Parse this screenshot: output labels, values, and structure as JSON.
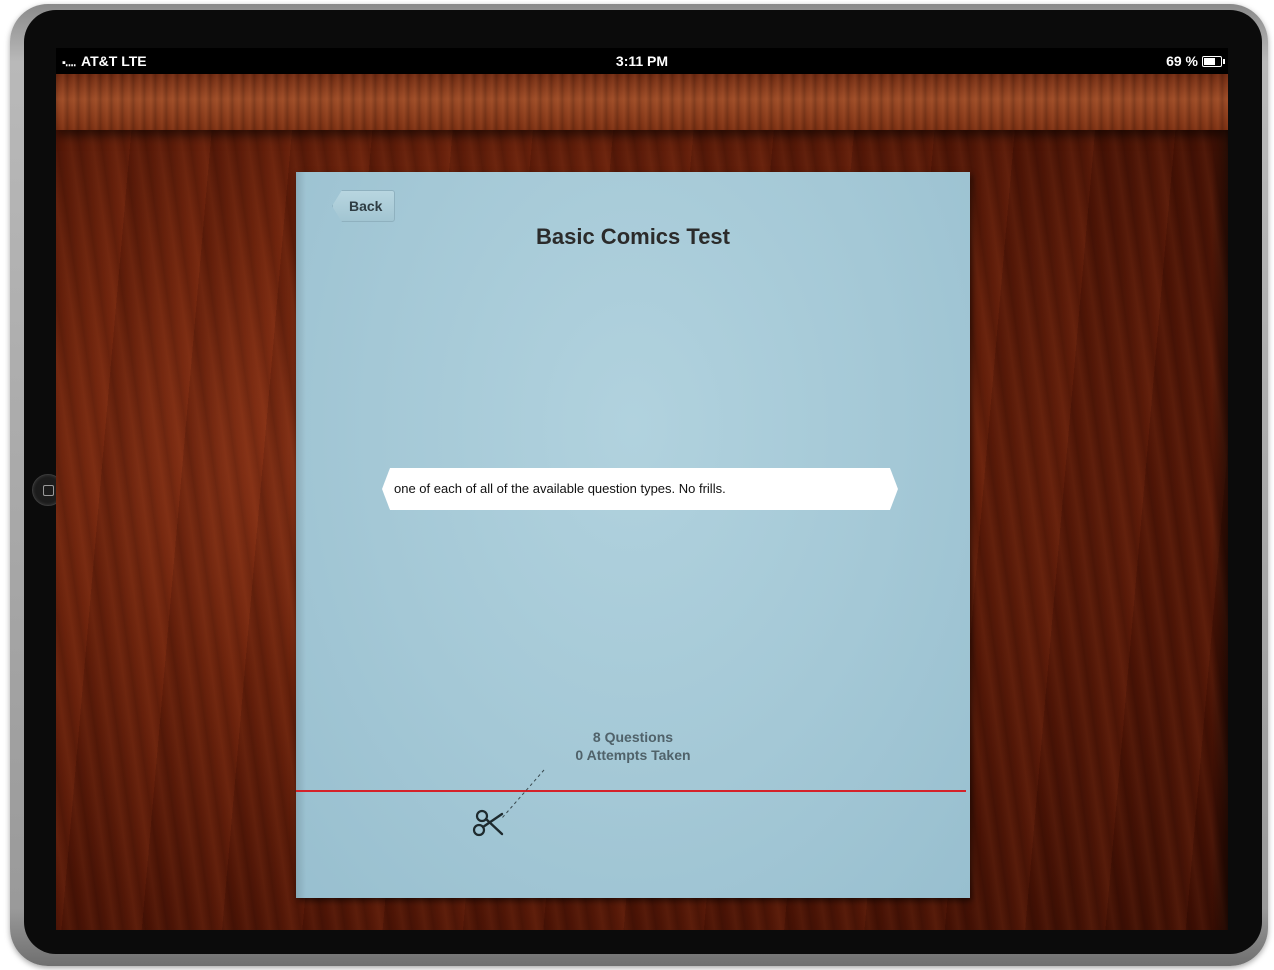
{
  "statusbar": {
    "signal": "▪․․․․",
    "carrier": "AT&T",
    "network": "LTE",
    "time": "3:11 PM",
    "battery": "69 %",
    "battery_level": 0.69
  },
  "notebook": {
    "back_label": "Back",
    "title": "Basic Comics Test",
    "description": "one of each of all of the available question types. No frills.",
    "questions": "8 Questions",
    "attempts": "0 Attempts Taken"
  },
  "colors": {
    "cover": "#a4c8d6",
    "cut_line": "#d4222a",
    "wood": "#6a220c"
  },
  "icons": [
    "home-button-icon",
    "battery-icon",
    "scissors-icon"
  ]
}
